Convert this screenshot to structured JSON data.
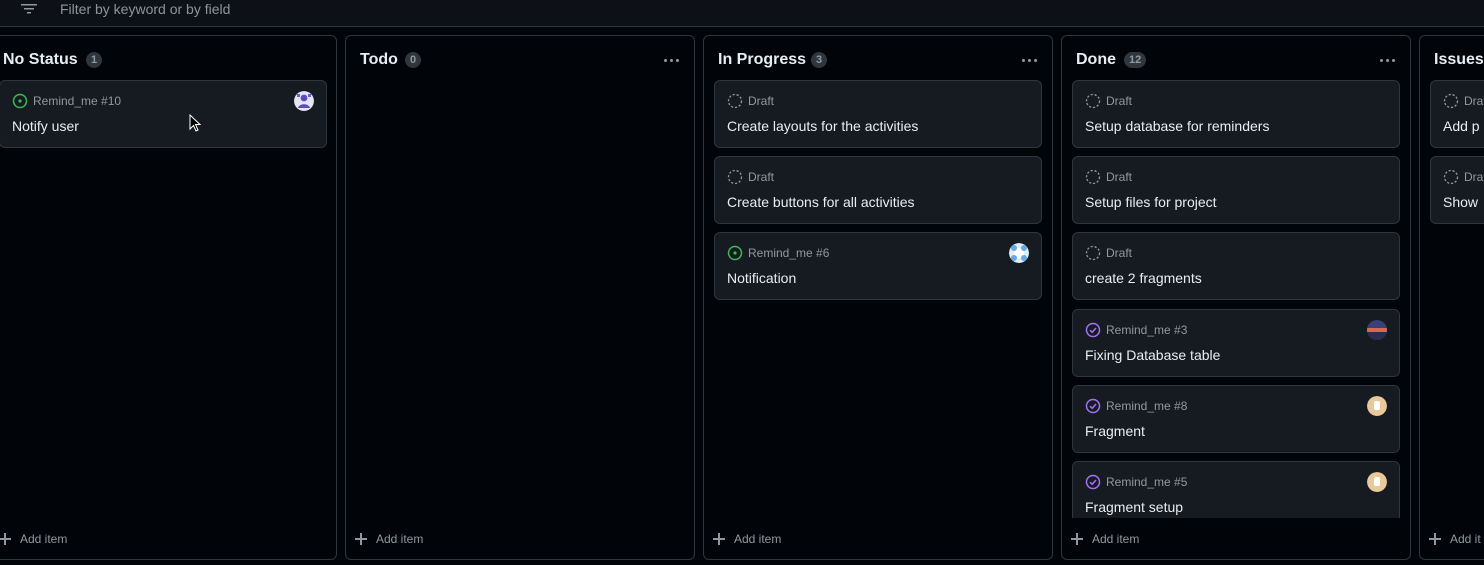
{
  "filter": {
    "placeholder": "Filter by keyword or by field"
  },
  "columns": [
    {
      "title": "No Status",
      "count": "1",
      "cards": [
        {
          "type": "issue-open",
          "meta": "Remind_me #10",
          "title": "Notify user",
          "avatar": "purple"
        }
      ],
      "add_label": "Add item"
    },
    {
      "title": "Todo",
      "count": "0",
      "cards": [],
      "add_label": "Add item"
    },
    {
      "title": "In Progress",
      "count": "3",
      "cards": [
        {
          "type": "draft",
          "meta": "Draft",
          "title": "Create layouts for the activities"
        },
        {
          "type": "draft",
          "meta": "Draft",
          "title": "Create buttons for all activities"
        },
        {
          "type": "issue-open",
          "meta": "Remind_me #6",
          "title": "Notification",
          "avatar": "blue"
        }
      ],
      "add_label": "Add item"
    },
    {
      "title": "Done",
      "count": "12",
      "cards": [
        {
          "type": "draft",
          "meta": "Draft",
          "title": "Setup database for reminders"
        },
        {
          "type": "draft",
          "meta": "Draft",
          "title": "Setup files for project"
        },
        {
          "type": "draft",
          "meta": "Draft",
          "title": "create 2 fragments"
        },
        {
          "type": "issue-closed",
          "meta": "Remind_me #3",
          "title": "Fixing Database table",
          "avatar": "sunset"
        },
        {
          "type": "issue-closed",
          "meta": "Remind_me #8",
          "title": "Fragment",
          "avatar": "tan"
        },
        {
          "type": "issue-closed",
          "meta": "Remind_me #5",
          "title": "Fragment setup",
          "avatar": "tan"
        }
      ],
      "add_label": "Add item"
    },
    {
      "title": "Issues",
      "cards": [
        {
          "type": "draft",
          "meta": "Draf",
          "title": "Add p"
        },
        {
          "type": "draft",
          "meta": "Draf",
          "title": "Show"
        }
      ],
      "add_label": "Add it"
    }
  ],
  "colors": {
    "open": "#3fb950",
    "closed": "#a371f7",
    "draft": "#9198a1",
    "card_bg": "#161b22",
    "border": "#30363d",
    "page_bg": "#010409"
  }
}
